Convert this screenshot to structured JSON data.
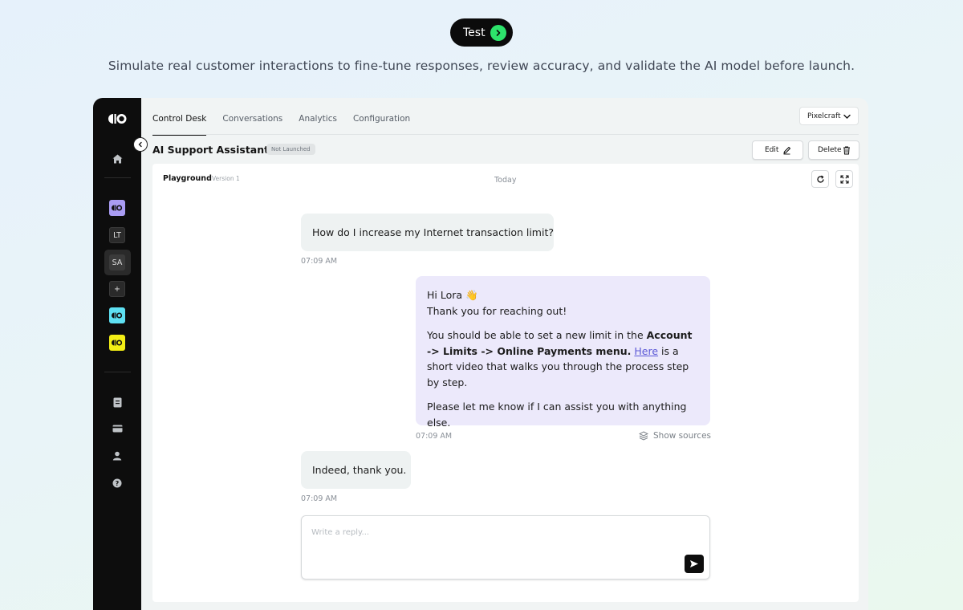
{
  "hero": {
    "pill_label": "Test",
    "subtitle": "Simulate real customer interactions to fine-tune responses, review accuracy, and validate the AI model before launch."
  },
  "sidebar": {
    "logo_icon": "io-logo",
    "items": [
      {
        "name": "home",
        "icon": "home-icon"
      },
      {
        "name": "workspace-io-purple",
        "icon": "io-logo",
        "color": "#a99cf3"
      },
      {
        "name": "workspace-lt",
        "label": "LT"
      },
      {
        "name": "workspace-sa",
        "label": "SA",
        "selected": true
      },
      {
        "name": "add-workspace",
        "label": "+"
      },
      {
        "name": "workspace-io-cyan",
        "icon": "io-logo",
        "color": "#5ee0f2"
      },
      {
        "name": "workspace-io-yellow",
        "icon": "io-logo",
        "color": "#f3ee15"
      },
      {
        "name": "docs",
        "icon": "document-icon"
      },
      {
        "name": "billing",
        "icon": "card-icon"
      },
      {
        "name": "account",
        "icon": "user-icon"
      },
      {
        "name": "help",
        "icon": "help-icon"
      }
    ]
  },
  "tabs": [
    {
      "label": "Control Desk",
      "active": true
    },
    {
      "label": "Conversations"
    },
    {
      "label": "Analytics"
    },
    {
      "label": "Configuration"
    }
  ],
  "workspace_select": {
    "value": "Pixelcraft"
  },
  "assistant": {
    "title": "AI Support Assistant",
    "status": "Not Launched",
    "edit_label": "Edit",
    "delete_label": "Delete"
  },
  "playground": {
    "label": "Playground",
    "version": "Version 1",
    "day": "Today",
    "messages": [
      {
        "role": "user",
        "text": "How do I increase my Internet transaction limit?",
        "time": "07:09 AM"
      },
      {
        "role": "bot",
        "greeting": "Hi Lora 👋",
        "line2": "Thank you for reaching out!",
        "p2_a": "You should be able to set a new limit in the ",
        "p2_bold": "Account -> Limits -> Online Payments menu.",
        "p2_link": "Here",
        "p2_b": " is a short video that walks you through the process step by step.",
        "p3": "Please let me know if I can assist you with anything else.",
        "time": "07:09 AM",
        "sources_label": "Show sources"
      },
      {
        "role": "user",
        "text": "Indeed, thank you.",
        "time": "07:09 AM"
      }
    ],
    "composer_placeholder": "Write a reply..."
  },
  "colors": {
    "accent_green": "#2de36b",
    "bot_bubble": "#ece9fb",
    "link": "#5b58d6"
  }
}
